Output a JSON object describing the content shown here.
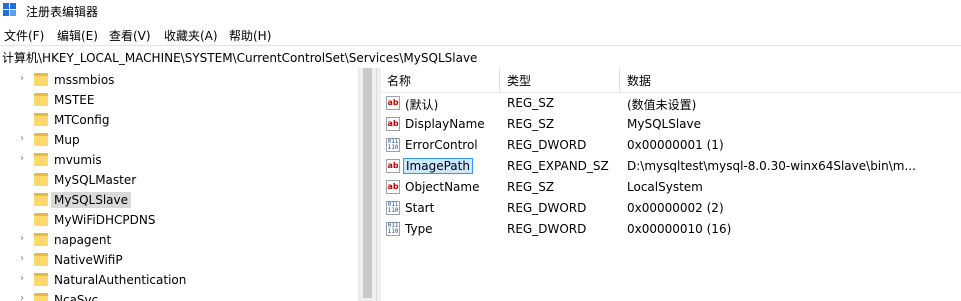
{
  "window": {
    "title": "注册表编辑器"
  },
  "menu": [
    "文件(F)",
    "编辑(E)",
    "查看(V)",
    "收藏夹(A)",
    "帮助(H)"
  ],
  "address": "计算机\\HKEY_LOCAL_MACHINE\\SYSTEM\\CurrentControlSet\\Services\\MySQLSlave",
  "tree": {
    "items": [
      {
        "label": "mssmbios",
        "expandable": true
      },
      {
        "label": "MSTEE",
        "expandable": false
      },
      {
        "label": "MTConfig",
        "expandable": false
      },
      {
        "label": "Mup",
        "expandable": true
      },
      {
        "label": "mvumis",
        "expandable": true
      },
      {
        "label": "MySQLMaster",
        "expandable": false
      },
      {
        "label": "MySQLSlave",
        "expandable": false,
        "selected": true
      },
      {
        "label": "MyWiFiDHCPDNS",
        "expandable": false
      },
      {
        "label": "napagent",
        "expandable": true
      },
      {
        "label": "NativeWifiP",
        "expandable": true
      },
      {
        "label": "NaturalAuthentication",
        "expandable": true
      },
      {
        "label": "NcaSvc",
        "expandable": true
      }
    ]
  },
  "list": {
    "headers": {
      "name": "名称",
      "type": "类型",
      "data": "数据"
    },
    "rows": [
      {
        "icon": "string-value-icon",
        "name": "(默认)",
        "type": "REG_SZ",
        "data": "(数值未设置)"
      },
      {
        "icon": "string-value-icon",
        "name": "DisplayName",
        "type": "REG_SZ",
        "data": "MySQLSlave"
      },
      {
        "icon": "binary-value-icon",
        "name": "ErrorControl",
        "type": "REG_DWORD",
        "data": "0x00000001 (1)"
      },
      {
        "icon": "string-value-icon",
        "name": "ImagePath",
        "type": "REG_EXPAND_SZ",
        "data": "D:\\mysqltest\\mysql-8.0.30-winx64Slave\\bin\\m...",
        "selected": true
      },
      {
        "icon": "string-value-icon",
        "name": "ObjectName",
        "type": "REG_SZ",
        "data": "LocalSystem"
      },
      {
        "icon": "binary-value-icon",
        "name": "Start",
        "type": "REG_DWORD",
        "data": "0x00000002 (2)"
      },
      {
        "icon": "binary-value-icon",
        "name": "Type",
        "type": "REG_DWORD",
        "data": "0x00000010 (16)"
      }
    ]
  },
  "icons": {
    "string_label": "ab",
    "binary_label": "011\n110"
  }
}
